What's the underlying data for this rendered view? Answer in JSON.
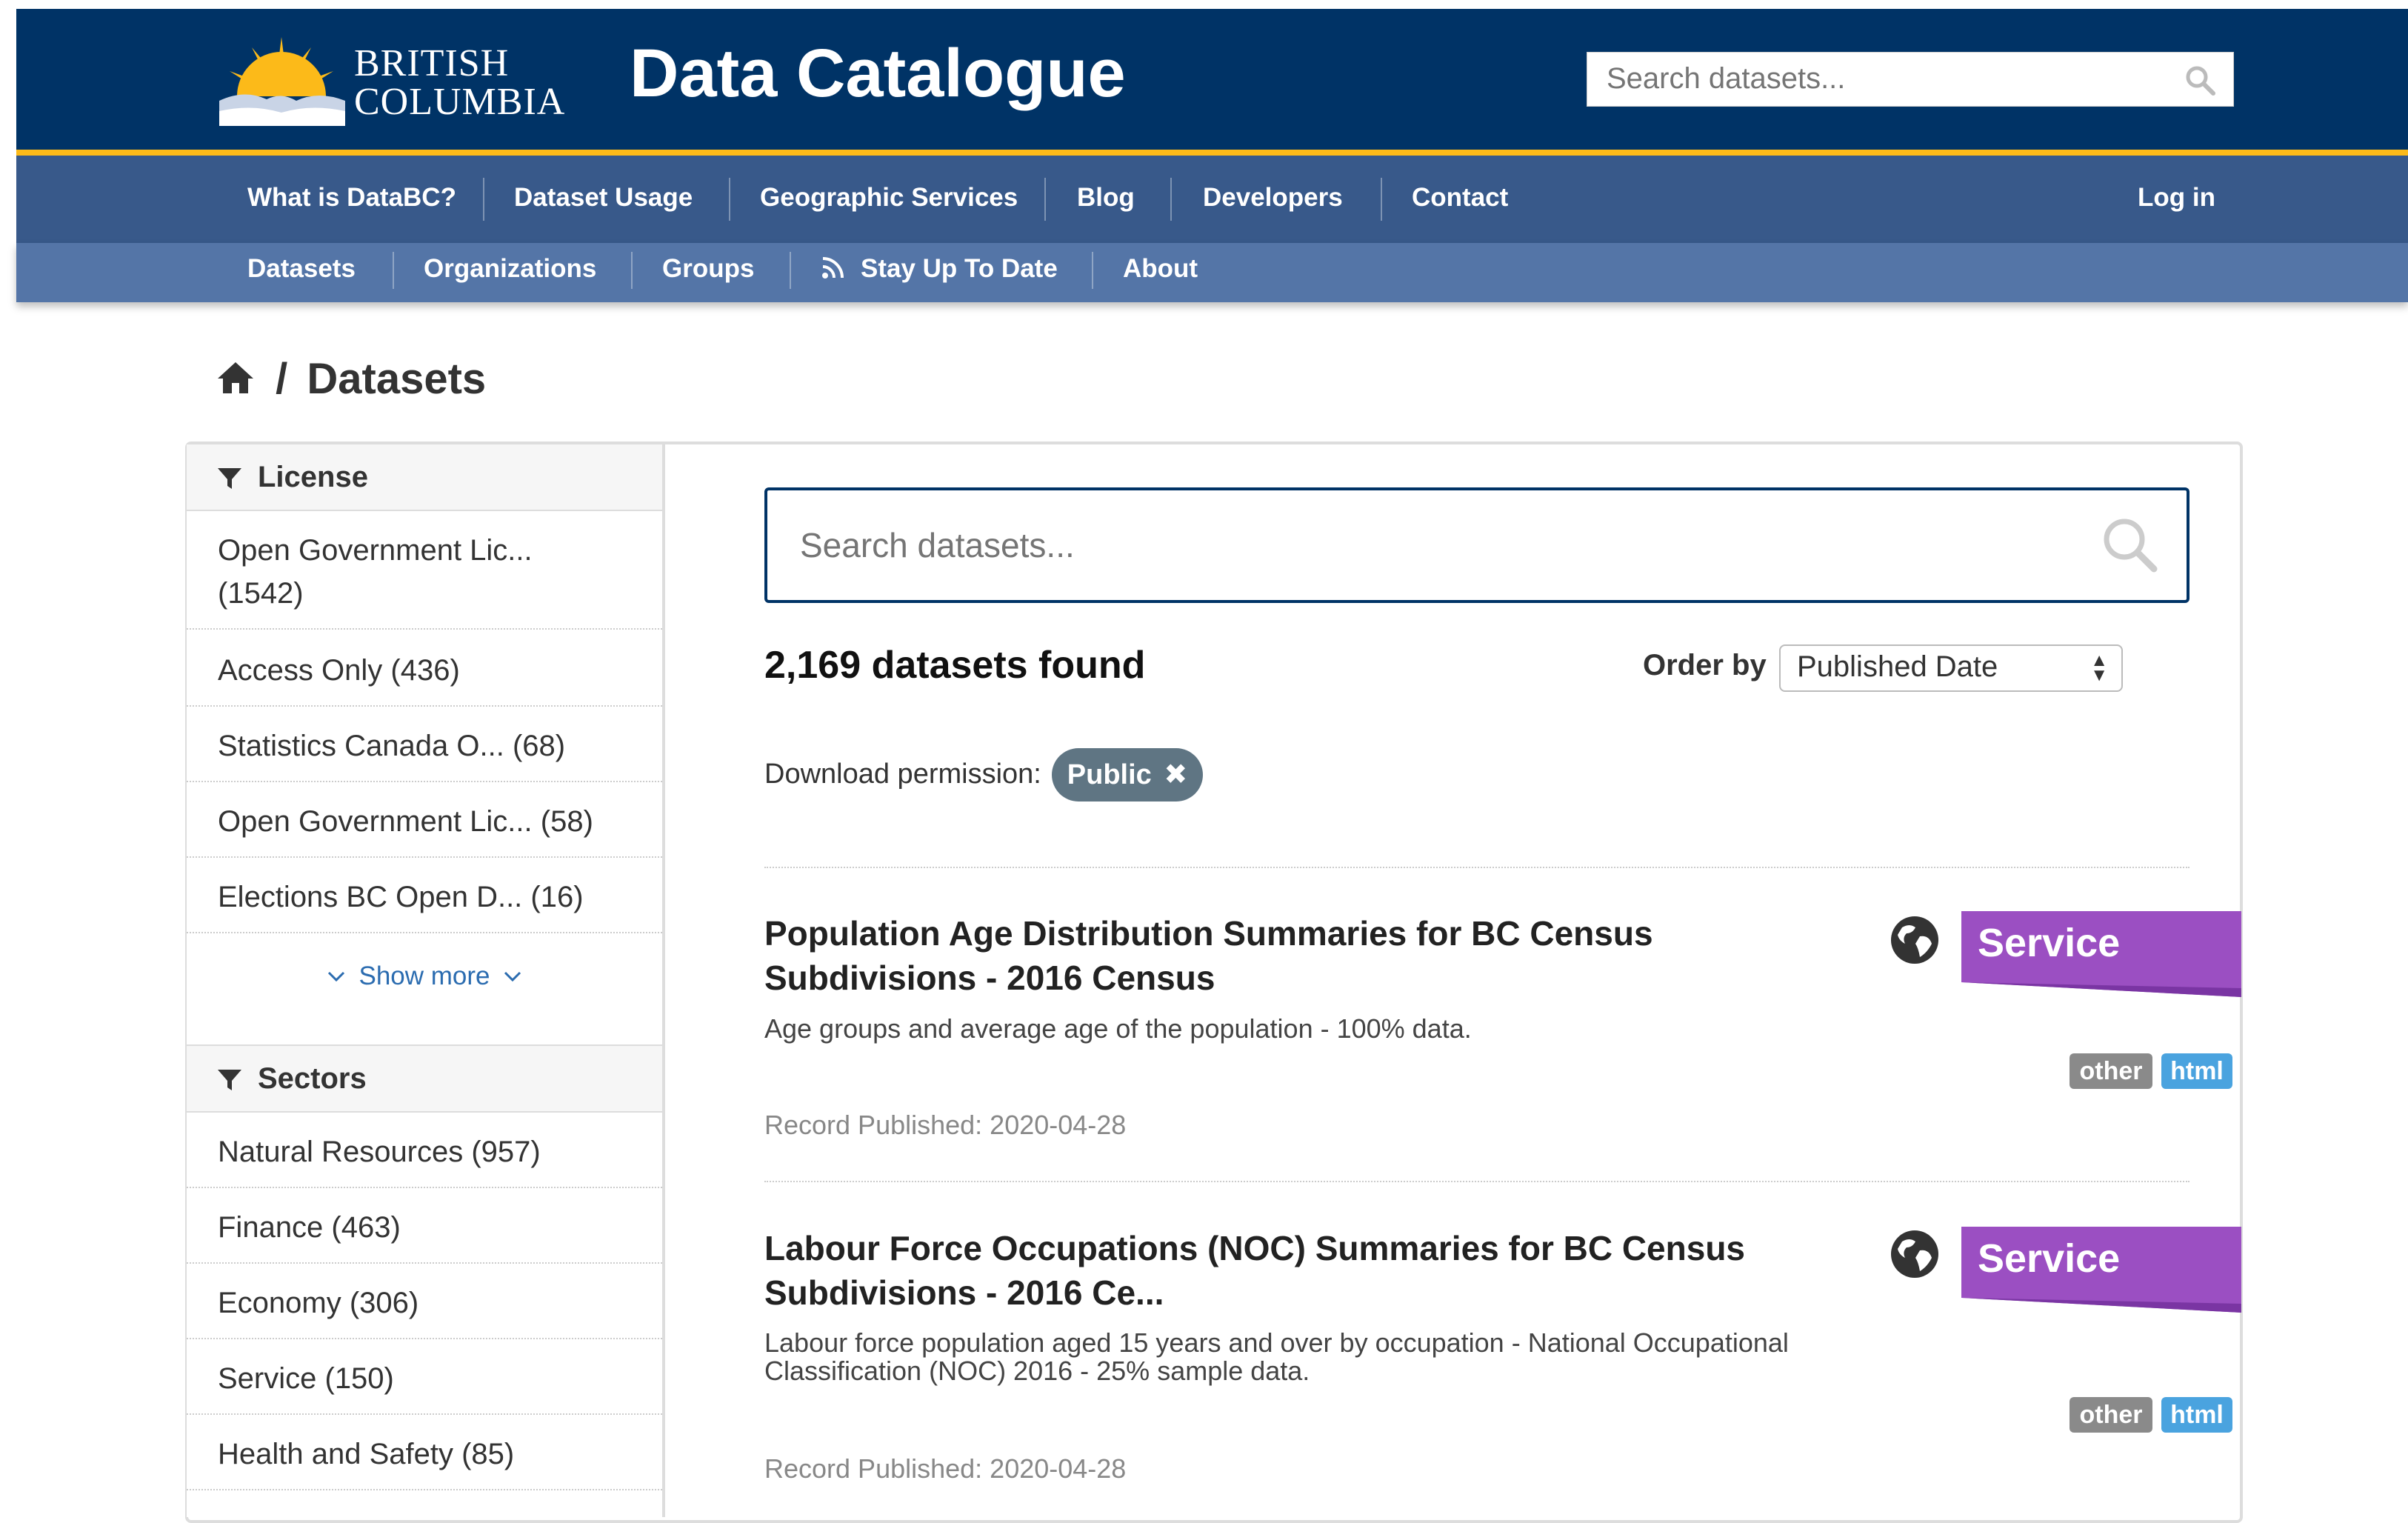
{
  "header": {
    "logo_line1": "BRITISH",
    "logo_line2": "COLUMBIA",
    "site_title": "Data Catalogue",
    "search_placeholder": "Search datasets..."
  },
  "nav_primary": [
    "What is DataBC?",
    "Dataset Usage",
    "Geographic Services",
    "Blog",
    "Developers",
    "Contact"
  ],
  "login_label": "Log in",
  "nav_secondary": [
    "Datasets",
    "Organizations",
    "Groups",
    "Stay Up To Date",
    "About"
  ],
  "breadcrumb": {
    "separator": "/",
    "current": "Datasets"
  },
  "facets": {
    "license": {
      "title": "License",
      "items": [
        "Open Government Lic... (1542)",
        "Access Only (436)",
        "Statistics Canada O... (68)",
        "Open Government Lic... (58)",
        "Elections BC Open D... (16)"
      ],
      "show_more": "Show more"
    },
    "sectors": {
      "title": "Sectors",
      "items": [
        "Natural Resources (957)",
        "Finance (463)",
        "Economy (306)",
        "Service (150)",
        "Health and Safety (85)"
      ]
    }
  },
  "main": {
    "search_placeholder": "Search datasets...",
    "found_text": "2,169 datasets found",
    "order_label": "Order by",
    "order_value": "Published Date",
    "filter_label": "Download permission:",
    "filter_pill": "Public"
  },
  "datasets": [
    {
      "title_line1": "Population Age Distribution Summaries for BC Census",
      "title_line2": "Subdivisions - 2016 Census",
      "description_line1": "Age groups and average age of the population - 100% data.",
      "description_line2": "",
      "published": "Record Published: 2020-04-28",
      "type": "Service",
      "formats": [
        "other",
        "html"
      ]
    },
    {
      "title_line1": "Labour Force Occupations (NOC) Summaries for BC Census",
      "title_line2": "Subdivisions - 2016 Ce...",
      "description_line1": "Labour force population aged 15 years and over by occupation - National Occupational",
      "description_line2": "Classification (NOC) 2016 - 25% sample data.",
      "published": "Record Published: 2020-04-28",
      "type": "Service",
      "formats": [
        "other",
        "html"
      ]
    }
  ],
  "colors": {
    "header_blue": "#003366",
    "gold": "#fcba19",
    "nav_blue": "#38598a",
    "subnav_blue": "#5475a7",
    "service_purple": "#9b4fc2",
    "pill_gray": "#5f7583",
    "badge_other": "#8a8a8a",
    "badge_html": "#4aa3df"
  }
}
